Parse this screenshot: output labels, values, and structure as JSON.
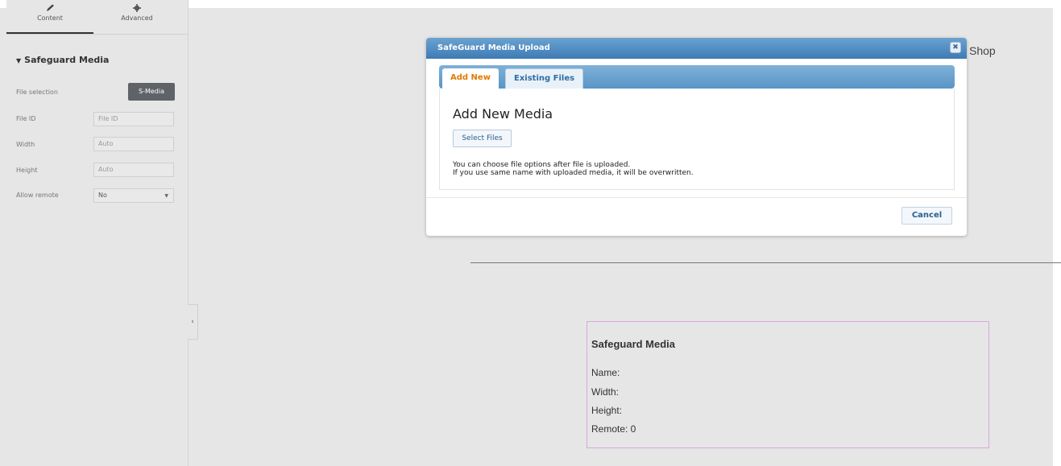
{
  "panel": {
    "tabs": [
      {
        "label": "Content",
        "icon": "pencil-icon"
      },
      {
        "label": "Advanced",
        "icon": "gear-icon"
      }
    ],
    "section_title": "Safeguard Media",
    "rows": {
      "file_selection": {
        "label": "File selection",
        "button": "S-Media"
      },
      "file_id": {
        "label": "File ID",
        "placeholder": "File ID"
      },
      "width": {
        "label": "Width",
        "placeholder": "Auto"
      },
      "height": {
        "label": "Height",
        "placeholder": "Auto"
      },
      "allow_remote": {
        "label": "Allow remote",
        "value": "No"
      }
    },
    "collapse_glyph": "‹"
  },
  "page": {
    "shop_text": "Shop"
  },
  "preview": {
    "title": "Safeguard Media",
    "name": "Name:",
    "width": "Width:",
    "height": "Height:",
    "remote": "Remote: 0"
  },
  "modal": {
    "title": "SafeGuard Media Upload",
    "close_glyph": "✖",
    "tabs": [
      "Add New",
      "Existing Files"
    ],
    "heading": "Add New Media",
    "select_files": "Select Files",
    "note_1": "You can choose file options after file is uploaded.",
    "note_2": "If you use same name with uploaded media, it will be overwritten.",
    "cancel": "Cancel"
  },
  "colors": {
    "accent_orange": "#e07b00",
    "titlebar_blue": "#4f8bc1",
    "panel_button": "#5f6368"
  }
}
